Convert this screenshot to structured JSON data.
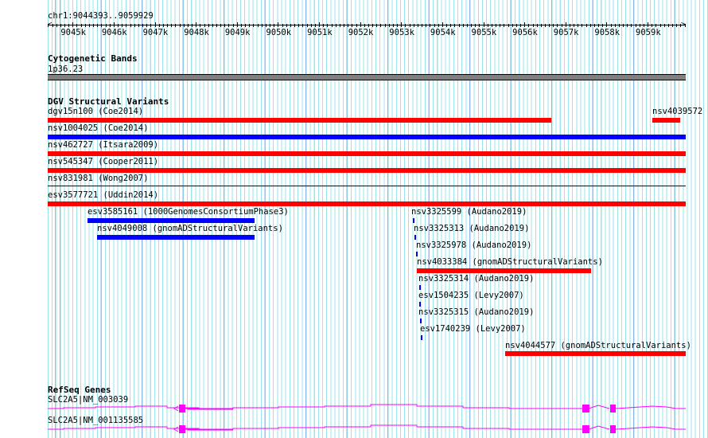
{
  "location": "chr1:9044393..9059929",
  "ruler_labels": [
    "9045k",
    "9046k",
    "9047k",
    "9048k",
    "9049k",
    "9050k",
    "9051k",
    "9052k",
    "9053k",
    "9054k",
    "9055k",
    "9056k",
    "9057k",
    "9058k",
    "9059k"
  ],
  "cytoband": {
    "title": "Cytogenetic Bands",
    "band": "1p36.23"
  },
  "dgv": {
    "title": "DGV Structural Variants",
    "features": [
      {
        "label": "dgv15n100 (Coe2014)",
        "color": "#ff0000"
      },
      {
        "label": "nsv4039572 (",
        "color": "#ff0000"
      },
      {
        "label": "nsv1004025 (Coe2014)",
        "color": "#0000ff"
      },
      {
        "label": "nsv462727 (Itsara2009)",
        "color": "#ff0000"
      },
      {
        "label": "nsv545347 (Cooper2011)",
        "color": "#ff0000"
      },
      {
        "label": "nsv831981 (Wong2007)",
        "color": "#000080"
      },
      {
        "label": "esv3577721 (Uddin2014)",
        "color": "#ff0000"
      },
      {
        "label": "esv3585161 (1000GenomesConsortiumPhase3)",
        "color": "#0000ff"
      },
      {
        "label": "nsv4049008 (gnomADStructuralVariants)",
        "color": "#0000ff"
      },
      {
        "label": "nsv3325599 (Audano2019)",
        "color": "#0000ff"
      },
      {
        "label": "nsv3325313 (Audano2019)",
        "color": "#0000ff"
      },
      {
        "label": "nsv3325978 (Audano2019)",
        "color": "#0000ff"
      },
      {
        "label": "nsv4033384 (gnomADStructuralVariants)",
        "color": "#ff0000"
      },
      {
        "label": "nsv3325314 (Audano2019)",
        "color": "#0000ff"
      },
      {
        "label": "esv1504235 (Levy2007)",
        "color": "#0000ff"
      },
      {
        "label": "nsv3325315 (Audano2019)",
        "color": "#0000ff"
      },
      {
        "label": "esv1740239 (Levy2007)",
        "color": "#0000ff"
      },
      {
        "label": "nsv4044577 (gnomADStructuralVariants)",
        "color": "#ff0000"
      }
    ]
  },
  "refseq": {
    "title": "RefSeq Genes",
    "transcripts": [
      {
        "label": "SLC2A5|NM_003039"
      },
      {
        "label": "SLC2A5|NM_001135585"
      }
    ],
    "color": "#ff00ff"
  }
}
